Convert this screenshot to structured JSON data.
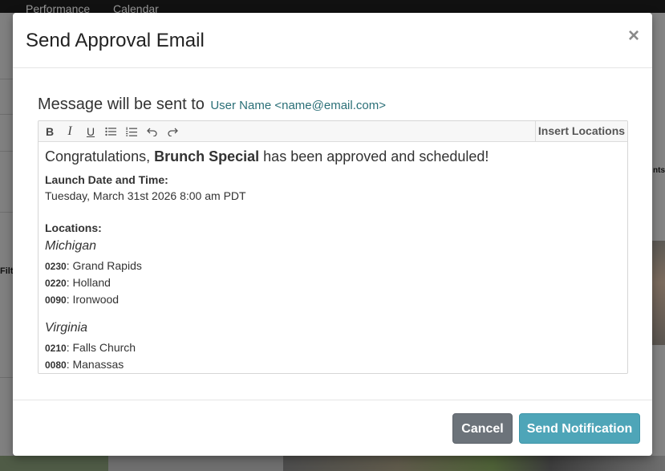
{
  "background": {
    "nav": [
      "Performance",
      "Calendar"
    ],
    "filter_text": "Filt",
    "right_text": "nts,"
  },
  "modal": {
    "title": "Send Approval Email",
    "close_icon": "×",
    "recipient": {
      "label": "Message will be sent to",
      "address": "User Name <name@email.com>"
    },
    "toolbar": {
      "bold": "B",
      "italic": "I",
      "underline": "U",
      "icons": [
        "bold-icon",
        "italic-icon",
        "underline-icon",
        "bullet-list-icon",
        "numbered-list-icon",
        "undo-icon",
        "redo-icon"
      ],
      "insert_locations": "Insert Locations"
    },
    "body": {
      "congrats_prefix": "Congratulations,",
      "promotion_name": "Brunch Special",
      "congrats_suffix": "has been approved and scheduled!",
      "launch_label": "Launch Date and Time:",
      "launch_value": "Tuesday, March 31st 2026 8:00 am PDT",
      "locations_label": "Locations:",
      "states": [
        {
          "name": "Michigan",
          "locations": [
            {
              "code": "0230",
              "name": "Grand Rapids"
            },
            {
              "code": "0220",
              "name": "Holland"
            },
            {
              "code": "0090",
              "name": "Ironwood"
            }
          ]
        },
        {
          "name": "Virginia",
          "locations": [
            {
              "code": "0210",
              "name": "Falls Church"
            },
            {
              "code": "0080",
              "name": "Manassas"
            }
          ]
        }
      ]
    },
    "footer": {
      "cancel_label": "Cancel",
      "send_label": "Send Notification"
    },
    "colors": {
      "cancel": "#6c737a",
      "send": "#4ea5b8",
      "recipient_link": "#2a6f77"
    }
  }
}
